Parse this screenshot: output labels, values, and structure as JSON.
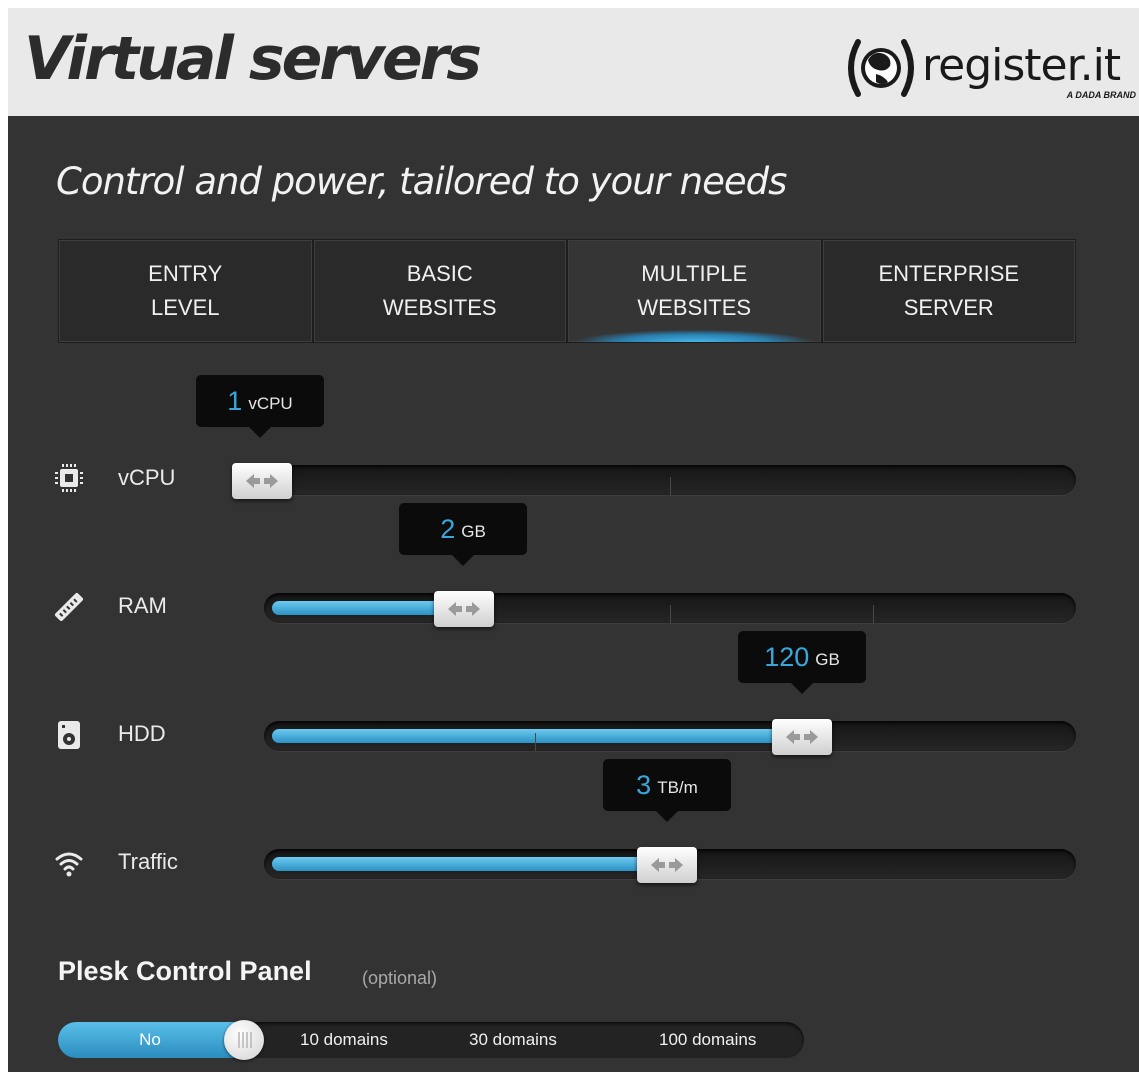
{
  "header": {
    "title": "Virtual servers",
    "logo_text": "register.it",
    "logo_sub": "A DADA BRAND"
  },
  "tagline": "Control and power, tailored to your needs",
  "tabs": [
    {
      "line1": "ENTRY",
      "line2": "LEVEL",
      "active": false
    },
    {
      "line1": "BASIC",
      "line2": "WEBSITES",
      "active": false
    },
    {
      "line1": "MULTIPLE",
      "line2": "WEBSITES",
      "active": true
    },
    {
      "line1": "ENTERPRISE",
      "line2": "SERVER",
      "active": false
    }
  ],
  "sliders": [
    {
      "label": "vCPU",
      "icon": "cpu-icon",
      "value": "1",
      "unit": "vCPU",
      "level": 0.0
    },
    {
      "label": "RAM",
      "icon": "ram-icon",
      "value": "2",
      "unit": "GB",
      "level": 0.22
    },
    {
      "label": "HDD",
      "icon": "hdd-icon",
      "value": "120",
      "unit": "GB",
      "level": 0.66
    },
    {
      "label": "Traffic",
      "icon": "wifi-icon",
      "value": "3",
      "unit": "TB/m",
      "level": 0.49
    }
  ],
  "plesk": {
    "title": "Plesk Control Panel",
    "optional": "(optional)",
    "selected": "No",
    "options": [
      "10 domains",
      "30 domains",
      "100 domains"
    ]
  },
  "colors": {
    "accent": "#3aa7dc",
    "panel": "#333333",
    "header": "#e9e9e9"
  }
}
